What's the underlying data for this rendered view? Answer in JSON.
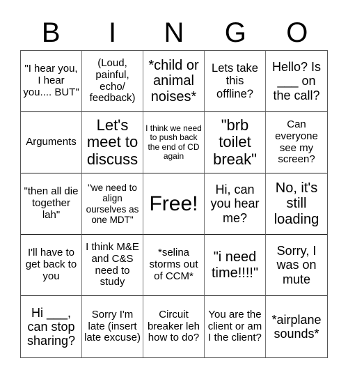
{
  "header": {
    "letters": [
      "B",
      "I",
      "N",
      "G",
      "O"
    ]
  },
  "cells": [
    "\"I hear you, I hear you.... BUT\"",
    "(Loud, painful, echo/ feedback)",
    "*child or animal noises*",
    "Lets take this offline?",
    "Hello? Is ___ on the call?",
    "Arguments",
    "Let's meet to discuss",
    "I think we need to push back the end of CD again",
    "\"brb toilet break\"",
    "Can everyone see my screen?",
    "\"then all die together lah\"",
    "\"we need to align ourselves as one MDT\"",
    "Free!",
    "Hi, can you hear me?",
    "No, it's still loading",
    "I'll have to get back to you",
    "I think M&E and C&S need to study",
    "*selina storms out of CCM*",
    "\"i need time!!!!\"",
    "Sorry, I was on mute",
    "Hi ___, can stop sharing?",
    "Sorry I'm late (insert late excuse)",
    "Circuit breaker leh how to do?",
    "You are the client or am I the client?",
    "*airplane sounds*"
  ]
}
